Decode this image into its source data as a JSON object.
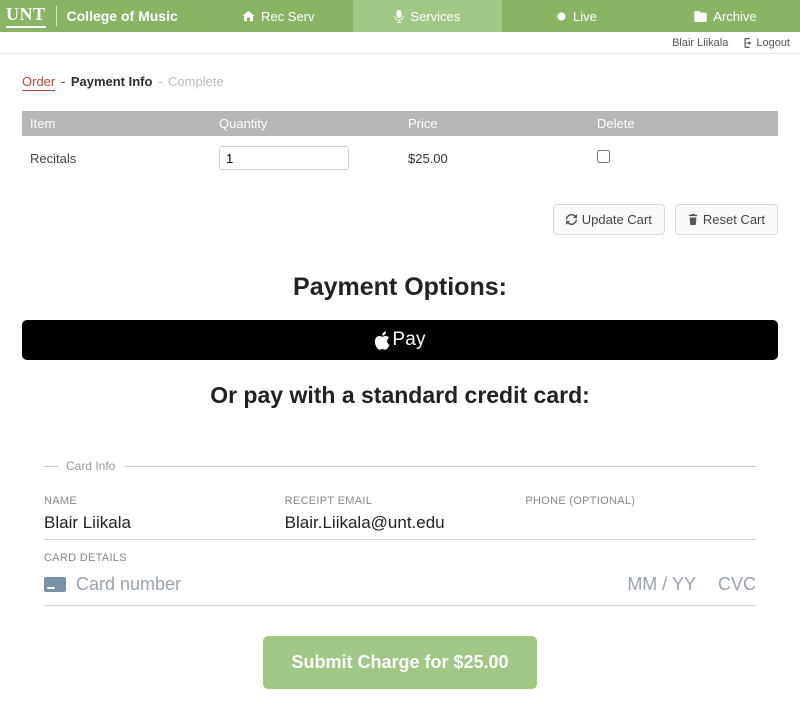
{
  "brand": {
    "logo": "UNT",
    "subtitle": "College of Music"
  },
  "nav": {
    "items": [
      {
        "label": "Rec Serv",
        "active": false
      },
      {
        "label": "Services",
        "active": true
      },
      {
        "label": "Live",
        "active": false
      },
      {
        "label": "Archive",
        "active": false
      }
    ]
  },
  "userbar": {
    "name": "Blair Liikala",
    "logout": "Logout"
  },
  "breadcrumb": {
    "order": "Order",
    "payment": "Payment Info",
    "complete": "Complete"
  },
  "cart": {
    "headers": {
      "item": "Item",
      "quantity": "Quantity",
      "price": "Price",
      "delete": "Delete"
    },
    "rows": [
      {
        "item": "Recitals",
        "quantity": "1",
        "price": "$25.00"
      }
    ],
    "update_label": "Update Cart",
    "reset_label": "Reset Cart"
  },
  "payment": {
    "options_title": "Payment Options:",
    "apple_pay_text": "Pay",
    "or_title": "Or pay with a standard credit card:"
  },
  "card": {
    "section_title": "Card Info",
    "name_label": "NAME",
    "name_value": "Blair Liikala",
    "email_label": "RECEIPT EMAIL",
    "email_value": "Blair.Liikala@unt.edu",
    "phone_label": "PHONE (OPTIONAL)",
    "phone_value": "",
    "details_label": "CARD DETAILS",
    "cc_placeholder": "Card number",
    "exp_placeholder": "MM / YY",
    "cvc_placeholder": "CVC"
  },
  "submit": {
    "label": "Submit Charge for $25.00"
  }
}
